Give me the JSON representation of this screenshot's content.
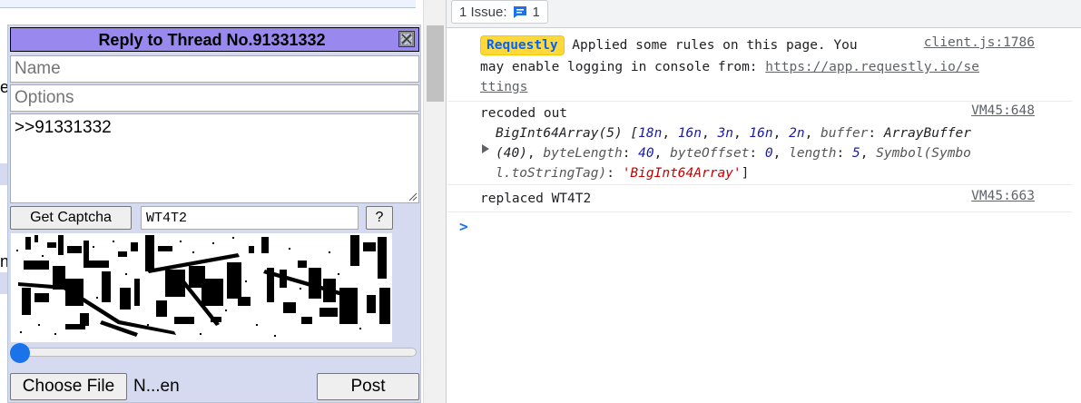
{
  "page": {
    "fragments": [
      "e",
      "n'"
    ]
  },
  "reply_window": {
    "title": "Reply to Thread No.91331332",
    "name_placeholder": "Name",
    "options_placeholder": "Options",
    "comment_value": ">>91331332",
    "get_captcha_label": "Get Captcha",
    "captcha_value": "WT4T2",
    "help_label": "?",
    "choose_file_label": "Choose File",
    "file_name": "N...en",
    "post_label": "Post"
  },
  "devtools": {
    "issues_label": "1 Issue:",
    "issues_count": "1",
    "messages": [
      {
        "badge": "Requestly",
        "line1": " Applied some rules on this page. You",
        "line2": "may enable logging in console from: ",
        "link_part1": "https://app.requestly.io/se",
        "link_part2": "ttings",
        "source": "client.js:1786"
      },
      {
        "line1": "recoded out",
        "source": "VM45:648",
        "array_head": "BigInt64Array(5) [",
        "values": [
          "18n",
          "16n",
          "3n",
          "16n",
          "2n"
        ],
        "buffer_key": "buffer",
        "buffer_val": "ArrayBuffer",
        "buffer_len": "(40)",
        "byteLength_key": "byteLength",
        "byteLength_val": "40",
        "byteOffset_key": "byteOffset",
        "byteOffset_val": "0",
        "length_key": "length",
        "length_val": "5",
        "symbol_part1": "Symbol(Symbo",
        "symbol_part2": "l.toStringTag)",
        "tag_val": "'BigInt64Array'"
      },
      {
        "line1": "replaced WT4T2",
        "source": "VM45:663"
      }
    ],
    "prompt": ">"
  },
  "colors": {
    "reply_header": "#9988ee",
    "reply_bg": "#d6daf0",
    "requestly_badge": "#ffd83b",
    "console_number": "#1a1aa6",
    "console_string": "#c80000"
  }
}
